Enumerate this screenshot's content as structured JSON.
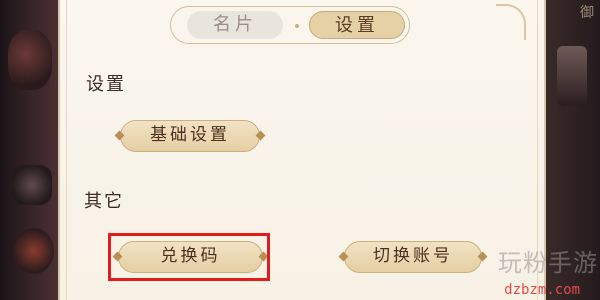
{
  "tabs": {
    "card": "名片",
    "settings": "设置"
  },
  "sections": {
    "settings_title": "设置",
    "other_title": "其它"
  },
  "buttons": {
    "basic_settings": "基础设置",
    "redeem_code": "兑换码",
    "switch_account": "切换账号"
  },
  "watermark": {
    "text": "玩粉手游",
    "url": "dzbzm.com"
  },
  "corner_glyph": "御",
  "colors": {
    "highlight_box": "#e01c1c",
    "button_fill": "#e5cfa4",
    "panel_bg": "#fbf7ef"
  }
}
